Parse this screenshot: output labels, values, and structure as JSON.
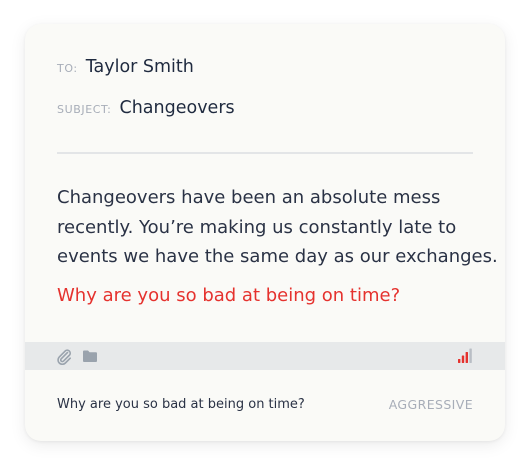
{
  "email": {
    "to_label": "TO:",
    "to_value": "Taylor Smith",
    "subject_label": "SUBJECT:",
    "subject_value": "Changeovers",
    "body_lines": [
      "Changeovers have been an absolute mess",
      "recently. You’re making us constantly late to",
      "events we have the same day as our exchanges."
    ],
    "highlighted_sentence": "Why are you so bad at being on time?"
  },
  "toolbar": {
    "icons": [
      "paperclip-icon",
      "folder-icon"
    ],
    "tone_meter_icon": "signal-bars-icon",
    "tone_level_bars": 3
  },
  "feedback": {
    "phrase": "Why are you so bad at being on time?",
    "tone_label": "AGGRESSIVE"
  },
  "colors": {
    "highlight": "#e5322e",
    "text": "#2a3245",
    "muted": "#a7adb8",
    "card": "#fafaf7",
    "toolbar": "#e7e9ea"
  }
}
